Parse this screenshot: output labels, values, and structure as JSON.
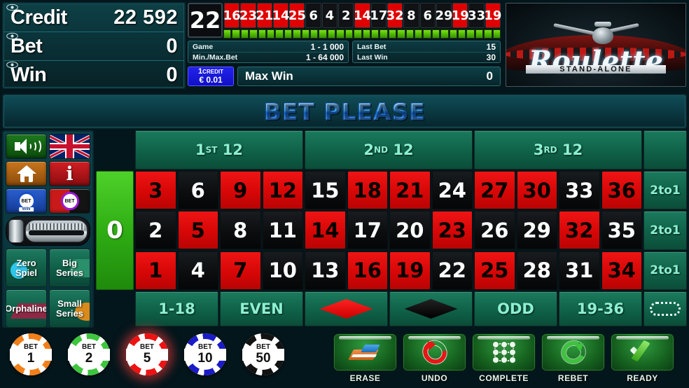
{
  "meters": [
    {
      "label": "Credit",
      "value": "22 592",
      "icon": "eye-icon"
    },
    {
      "label": "Bet",
      "value": "0",
      "icon": "eye-icon"
    },
    {
      "label": "Win",
      "value": "0",
      "icon": "eye-icon"
    }
  ],
  "result": {
    "last_number": "22"
  },
  "history": [
    {
      "n": "16",
      "color": "red"
    },
    {
      "n": "23",
      "color": "red"
    },
    {
      "n": "21",
      "color": "red"
    },
    {
      "n": "14",
      "color": "red"
    },
    {
      "n": "25",
      "color": "red"
    },
    {
      "n": "6",
      "color": "black"
    },
    {
      "n": "4",
      "color": "black"
    },
    {
      "n": "2",
      "color": "black"
    },
    {
      "n": "14",
      "color": "red"
    },
    {
      "n": "17",
      "color": "black"
    },
    {
      "n": "32",
      "color": "red"
    },
    {
      "n": "8",
      "color": "black"
    },
    {
      "n": "6",
      "color": "black"
    },
    {
      "n": "29",
      "color": "black"
    },
    {
      "n": "19",
      "color": "red"
    },
    {
      "n": "33",
      "color": "black"
    },
    {
      "n": "19",
      "color": "red"
    }
  ],
  "segments": 32,
  "info": {
    "game_label": "Game",
    "game_value": "1 - 1 000",
    "minmax_label": "Min./Max.Bet",
    "minmax_value": "1 - 64 000",
    "last_bet_label": "Last Bet",
    "last_bet_value": "15",
    "last_win_label": "Last Win",
    "last_win_value": "30"
  },
  "denomination": {
    "credits": "1",
    "credits_unit": "CREDIT",
    "value": "€ 0.01"
  },
  "max_win": {
    "label": "Max Win",
    "value": "0"
  },
  "logo": {
    "title": "Roulette",
    "subtitle": "STAND-ALONE"
  },
  "banner": {
    "text": "BET PLEASE"
  },
  "sidebar": {
    "buttons": [
      {
        "name": "sound-button",
        "icon": "speaker-icon",
        "label": ""
      },
      {
        "name": "language-button",
        "icon": "uk-flag-icon",
        "label": ""
      },
      {
        "name": "home-button",
        "icon": "home-icon",
        "label": ""
      },
      {
        "name": "info-button",
        "icon": "info-icon",
        "label": "i"
      },
      {
        "name": "bet-win-button",
        "icon": "chip-icon",
        "label": "BET",
        "sub": "WIN"
      },
      {
        "name": "bet-limits-button",
        "icon": "chip-icon",
        "label": "BET"
      }
    ],
    "racetrack_label": "racetrack-slider",
    "special_bets": [
      {
        "label1": "Zero",
        "label2": "Spiel",
        "name": "zero-spiel-button"
      },
      {
        "label1": "Big",
        "label2": "Series",
        "name": "big-series-button"
      },
      {
        "label1": "Orphaline",
        "label2": "",
        "name": "orphaline-button"
      },
      {
        "label1": "Small",
        "label2": "Series",
        "name": "small-series-button"
      }
    ]
  },
  "table": {
    "dozens": [
      {
        "ord": "1",
        "sup": "ST",
        "num": "12"
      },
      {
        "ord": "2",
        "sup": "ND",
        "num": "12"
      },
      {
        "ord": "3",
        "sup": "RD",
        "num": "12"
      }
    ],
    "zero": "0",
    "rows": [
      [
        {
          "n": "3",
          "c": "red"
        },
        {
          "n": "6",
          "c": "black"
        },
        {
          "n": "9",
          "c": "red"
        },
        {
          "n": "12",
          "c": "red"
        },
        {
          "n": "15",
          "c": "black"
        },
        {
          "n": "18",
          "c": "red"
        },
        {
          "n": "21",
          "c": "red"
        },
        {
          "n": "24",
          "c": "black"
        },
        {
          "n": "27",
          "c": "red"
        },
        {
          "n": "30",
          "c": "red"
        },
        {
          "n": "33",
          "c": "black"
        },
        {
          "n": "36",
          "c": "red"
        }
      ],
      [
        {
          "n": "2",
          "c": "black"
        },
        {
          "n": "5",
          "c": "red"
        },
        {
          "n": "8",
          "c": "black"
        },
        {
          "n": "11",
          "c": "black"
        },
        {
          "n": "14",
          "c": "red"
        },
        {
          "n": "17",
          "c": "black"
        },
        {
          "n": "20",
          "c": "black"
        },
        {
          "n": "23",
          "c": "red"
        },
        {
          "n": "26",
          "c": "black"
        },
        {
          "n": "29",
          "c": "black"
        },
        {
          "n": "32",
          "c": "red"
        },
        {
          "n": "35",
          "c": "black"
        }
      ],
      [
        {
          "n": "1",
          "c": "red"
        },
        {
          "n": "4",
          "c": "black"
        },
        {
          "n": "7",
          "c": "red"
        },
        {
          "n": "10",
          "c": "black"
        },
        {
          "n": "13",
          "c": "black"
        },
        {
          "n": "16",
          "c": "red"
        },
        {
          "n": "19",
          "c": "red"
        },
        {
          "n": "22",
          "c": "black"
        },
        {
          "n": "25",
          "c": "red"
        },
        {
          "n": "28",
          "c": "black"
        },
        {
          "n": "31",
          "c": "black"
        },
        {
          "n": "34",
          "c": "red"
        }
      ]
    ],
    "columns_bets": [
      "2to1",
      "2to1",
      "2to1"
    ],
    "outside_bets": [
      {
        "label": "1-18",
        "kind": "text"
      },
      {
        "label": "EVEN",
        "kind": "text"
      },
      {
        "label": "RED",
        "kind": "diamond-red"
      },
      {
        "label": "BLACK",
        "kind": "diamond-black"
      },
      {
        "label": "ODD",
        "kind": "text"
      },
      {
        "label": "19-36",
        "kind": "text"
      },
      {
        "label": "SNAKE",
        "kind": "snake"
      }
    ]
  },
  "chips": [
    {
      "bet": "BET",
      "amount": "1",
      "color": "#F28019",
      "selected": false
    },
    {
      "bet": "BET",
      "amount": "2",
      "color": "#3FC63F",
      "selected": false
    },
    {
      "bet": "BET",
      "amount": "5",
      "color": "#EE1212",
      "selected": true
    },
    {
      "bet": "BET",
      "amount": "10",
      "color": "#1B1BC8",
      "selected": false
    },
    {
      "bet": "BET",
      "amount": "50",
      "color": "#121212",
      "selected": false
    }
  ],
  "actions": [
    {
      "label": "ERASE",
      "icon": "eraser-icon"
    },
    {
      "label": "UNDO",
      "icon": "undo-arrow-icon"
    },
    {
      "label": "COMPLETE",
      "icon": "grid-dots-icon"
    },
    {
      "label": "REBET",
      "icon": "refresh-arrow-icon"
    },
    {
      "label": "READY",
      "icon": "checkmark-icon"
    }
  ],
  "colors": {
    "felt_green": "#0f6148",
    "number_red": "#d40606",
    "number_black": "#0a0c0e",
    "zero_green": "#2fae14",
    "accent_cyan": "#8df0d0",
    "banner_blue": "#4aa8f5"
  }
}
